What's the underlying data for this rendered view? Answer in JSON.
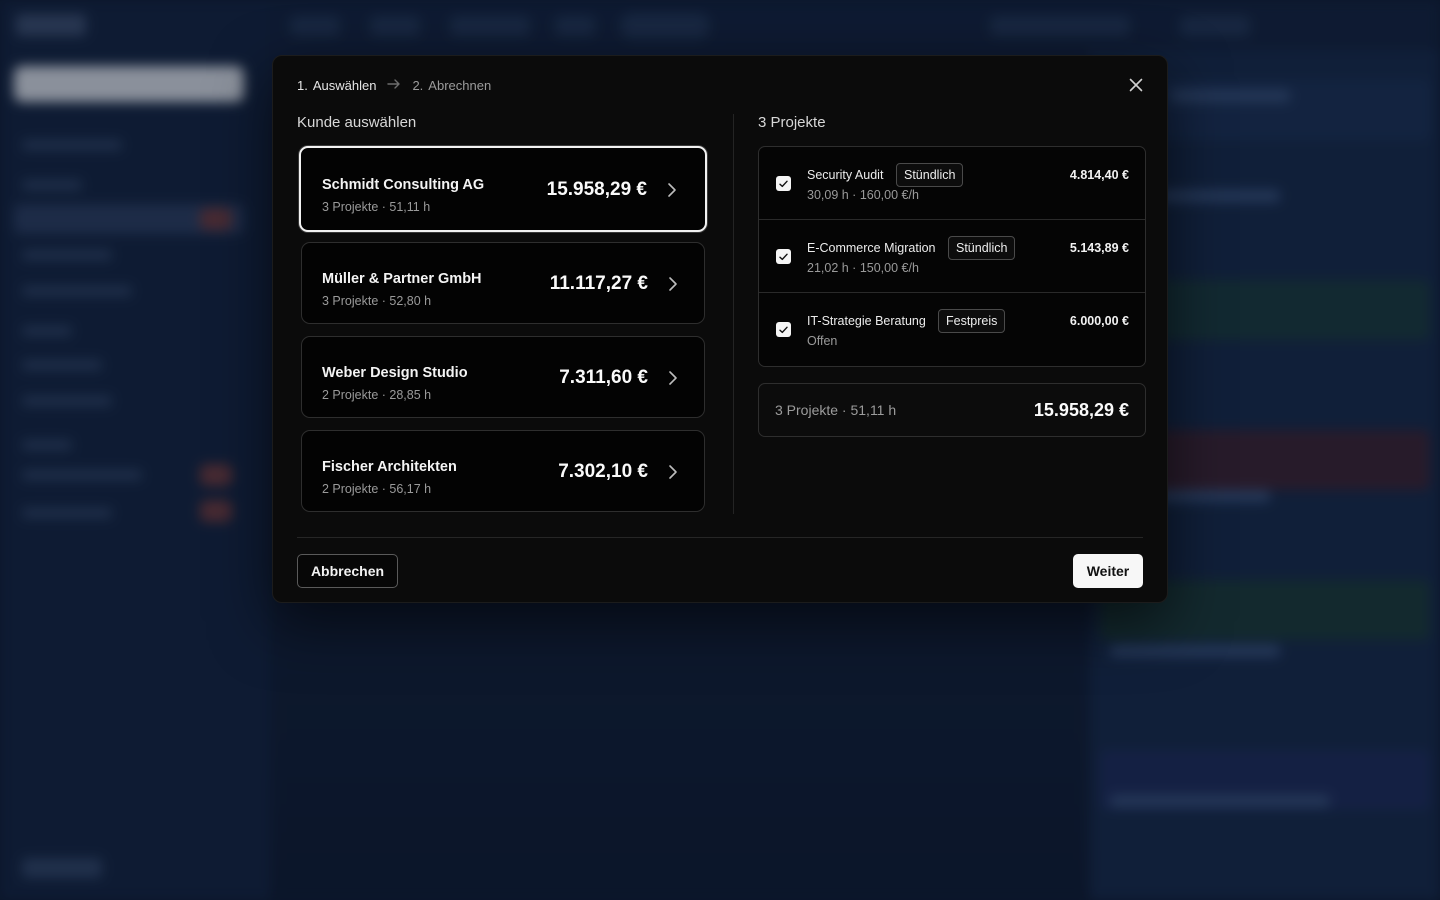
{
  "stepper": {
    "step1_number": "1.",
    "step1_label": "Auswählen",
    "step2_number": "2.",
    "step2_label": "Abrechnen"
  },
  "left": {
    "title": "Kunde auswählen",
    "customers": [
      {
        "name": "Schmidt Consulting AG",
        "meta": "3 Projekte · 51,11 h",
        "amount": "15.958,29 €"
      },
      {
        "name": "Müller & Partner GmbH",
        "meta": "3 Projekte · 52,80 h",
        "amount": "11.117,27 €"
      },
      {
        "name": "Weber Design Studio",
        "meta": "2 Projekte · 28,85 h",
        "amount": "7.311,60 €"
      },
      {
        "name": "Fischer Architekten",
        "meta": "2 Projekte · 56,17 h",
        "amount": "7.302,10 €"
      }
    ]
  },
  "right": {
    "title": "3 Projekte",
    "projects": [
      {
        "name": "Security Audit",
        "badge": "Stündlich",
        "meta": "30,09 h · 160,00 €/h",
        "amount": "4.814,40 €",
        "checked": true
      },
      {
        "name": "E-Commerce Migration",
        "badge": "Stündlich",
        "meta": "21,02 h · 150,00 €/h",
        "amount": "5.143,89 €",
        "checked": true
      },
      {
        "name": "IT-Strategie Beratung",
        "badge": "Festpreis",
        "meta": "Offen",
        "amount": "6.000,00 €",
        "checked": true
      }
    ],
    "summary_label": "3 Projekte · 51,11 h",
    "summary_amount": "15.958,29 €"
  },
  "footer": {
    "cancel_label": "Abbrechen",
    "next_label": "Weiter"
  }
}
